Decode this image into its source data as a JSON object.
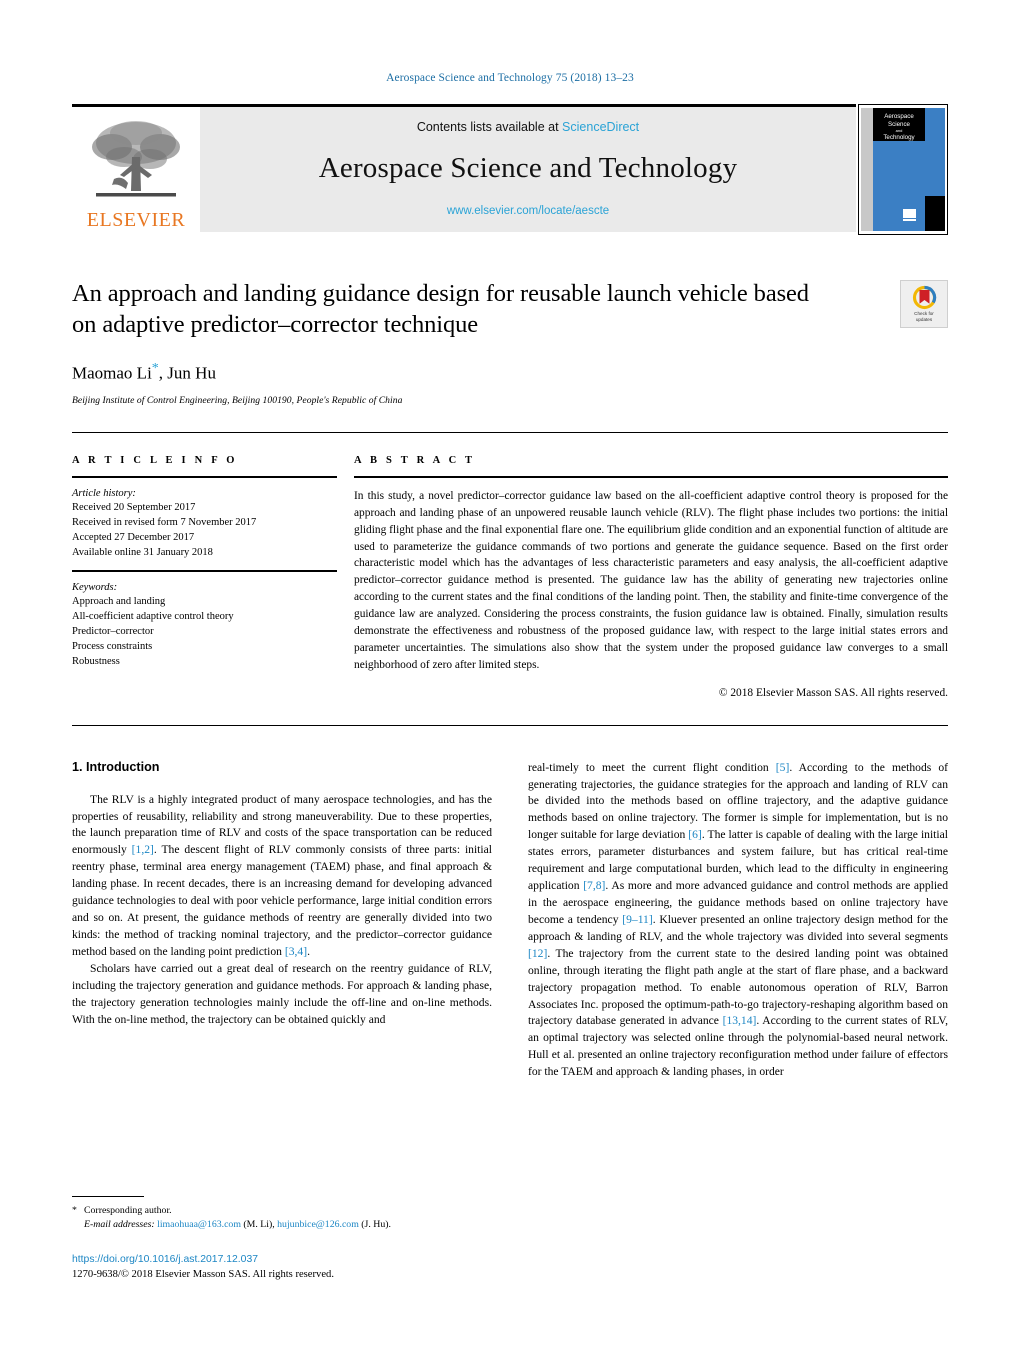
{
  "running_head": "Aerospace Science and Technology 75 (2018) 13–23",
  "masthead": {
    "contents_prefix": "Contents lists available at",
    "sciencedirect_label": "ScienceDirect",
    "journal_title": "Aerospace Science and Technology",
    "journal_url": "www.elsevier.com/locate/aescte",
    "publisher_logo_text": "ELSEVIER",
    "cover_title_lines": [
      "Aerospace",
      "Science",
      "and",
      "Technology"
    ],
    "cover_accent_color": "#3b7fc4"
  },
  "article": {
    "title": "An approach and landing guidance design for reusable launch vehicle based on adaptive predictor–corrector technique",
    "authors": "Maomao Li",
    "author_marker": "*",
    "authors_rest": ", Jun Hu",
    "affiliation": "Beijing Institute of Control Engineering, Beijing 100190, People's Republic of China",
    "crossmark_label_line1": "Check for",
    "crossmark_label_line2": "updates"
  },
  "article_info": {
    "heading": "A R T I C L E   I N F O",
    "history_title": "Article history:",
    "history": [
      "Received 20 September 2017",
      "Received in revised form 7 November 2017",
      "Accepted 27 December 2017",
      "Available online 31 January 2018"
    ],
    "keywords_title": "Keywords:",
    "keywords": [
      "Approach and landing",
      "All-coefficient adaptive control theory",
      "Predictor–corrector",
      "Process constraints",
      "Robustness"
    ]
  },
  "abstract": {
    "heading": "A B S T R A C T",
    "body": "In this study, a novel predictor–corrector guidance law based on the all-coefficient adaptive control theory is proposed for the approach and landing phase of an unpowered reusable launch vehicle (RLV). The flight phase includes two portions: the initial gliding flight phase and the final exponential flare one. The equilibrium glide condition and an exponential function of altitude are used to parameterize the guidance commands of two portions and generate the guidance sequence. Based on the first order characteristic model which has the advantages of less characteristic parameters and easy analysis, the all-coefficient adaptive predictor–corrector guidance method is presented. The guidance law has the ability of generating new trajectories online according to the current states and the final conditions of the landing point. Then, the stability and finite-time convergence of the guidance law are analyzed. Considering the process constraints, the fusion guidance law is obtained. Finally, simulation results demonstrate the effectiveness and robustness of the proposed guidance law, with respect to the large initial states errors and parameter uncertainties. The simulations also show that the system under the proposed guidance law converges to a small neighborhood of zero after limited steps.",
    "copyright": "© 2018 Elsevier Masson SAS. All rights reserved."
  },
  "body": {
    "section_heading": "1. Introduction",
    "left_paragraphs": [
      {
        "parts": [
          {
            "t": "The RLV is a highly integrated product of many aerospace technologies, and has the properties of reusability, reliability and strong maneuverability. Due to these properties, the launch preparation time of RLV and costs of the space transportation can be reduced enormously ",
            "r": false
          },
          {
            "t": "[1,2]",
            "r": true
          },
          {
            "t": ". The descent flight of RLV commonly consists of three parts: initial reentry phase, terminal area energy management (TAEM) phase, and final approach & landing phase. In recent decades, there is an increasing demand for developing advanced guidance technologies to deal with poor vehicle performance, large initial condition errors and so on. At present, the guidance methods of reentry are generally divided into two kinds: the method of tracking nominal trajectory, and the predictor–corrector guidance method based on the landing point prediction ",
            "r": false
          },
          {
            "t": "[3,4]",
            "r": true
          },
          {
            "t": ".",
            "r": false
          }
        ]
      },
      {
        "parts": [
          {
            "t": "Scholars have carried out a great deal of research on the reentry guidance of RLV, including the trajectory generation and guidance methods. For approach & landing phase, the trajectory generation technologies mainly include the off-line and on-line methods. With the on-line method, the trajectory can be obtained quickly and",
            "r": false
          }
        ]
      }
    ],
    "right_paragraphs": [
      {
        "indent": false,
        "parts": [
          {
            "t": "real-timely to meet the current flight condition ",
            "r": false
          },
          {
            "t": "[5]",
            "r": true
          },
          {
            "t": ". According to the methods of generating trajectories, the guidance strategies for the approach and landing of RLV can be divided into the methods based on offline trajectory, and the adaptive guidance methods based on online trajectory. The former is simple for implementation, but is no longer suitable for large deviation ",
            "r": false
          },
          {
            "t": "[6]",
            "r": true
          },
          {
            "t": ". The latter is capable of dealing with the large initial states errors, parameter disturbances and system failure, but has critical real-time requirement and large computational burden, which lead to the difficulty in engineering application ",
            "r": false
          },
          {
            "t": "[7,8]",
            "r": true
          },
          {
            "t": ". As more and more advanced guidance and control methods are applied in the aerospace engineering, the guidance methods based on online trajectory have become a tendency ",
            "r": false
          },
          {
            "t": "[9–11]",
            "r": true
          },
          {
            "t": ". Kluever presented an online trajectory design method for the approach & landing of RLV, and the whole trajectory was divided into several segments ",
            "r": false
          },
          {
            "t": "[12]",
            "r": true
          },
          {
            "t": ". The trajectory from the current state to the desired landing point was obtained online, through iterating the flight path angle at the start of flare phase, and a backward trajectory propagation method. To enable autonomous operation of RLV, Barron Associates Inc. proposed the optimum-path-to-go trajectory-reshaping algorithm based on trajectory database generated in advance ",
            "r": false
          },
          {
            "t": "[13,14]",
            "r": true
          },
          {
            "t": ". According to the current states of RLV, an optimal trajectory was selected online through the polynomial-based neural network. Hull et al. presented an online trajectory reconfiguration method under failure of effectors for the TAEM and approach & landing phases, in order",
            "r": false
          }
        ]
      }
    ]
  },
  "footnote": {
    "star": "*",
    "corresponding": "Corresponding author.",
    "email_label": "E-mail addresses:",
    "email1": "limaohuaa@163.com",
    "email1_owner": "(M. Li),",
    "email2": "hujunbice@126.com",
    "email2_owner": "(J. Hu)."
  },
  "footer": {
    "doi": "https://doi.org/10.1016/j.ast.2017.12.037",
    "copyright": "1270-9638/© 2018 Elsevier Masson SAS. All rights reserved."
  }
}
